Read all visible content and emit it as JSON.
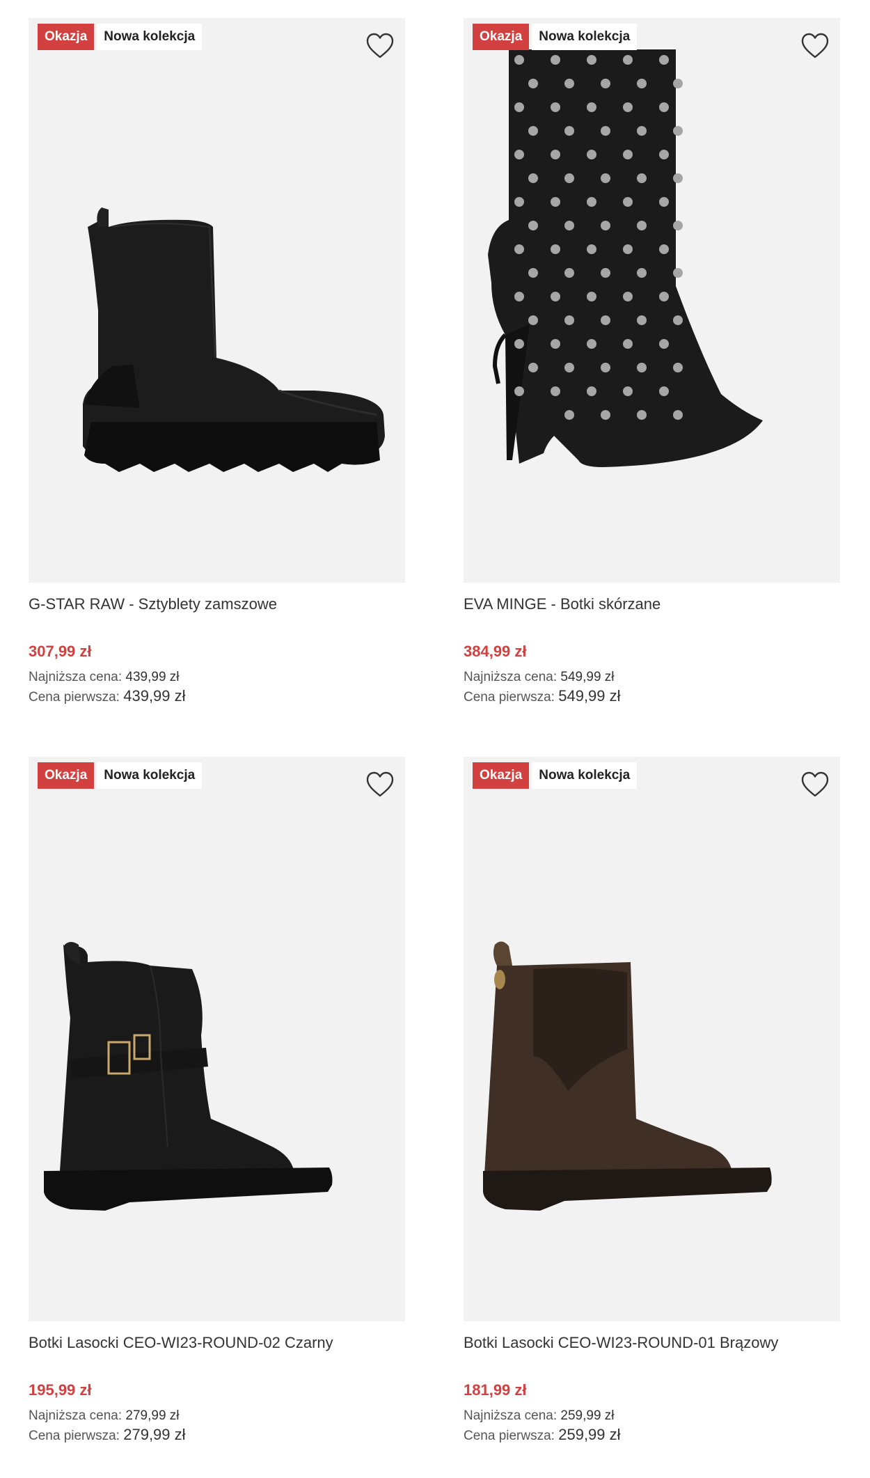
{
  "products": [
    {
      "sale_badge": "Okazja",
      "new_badge": "Nowa kolekcja",
      "title": "G-STAR RAW - Sztyblety zamszowe",
      "price": "307,99 zł",
      "lowest_label": "Najniższa cena:",
      "lowest_value": "439,99 zł",
      "first_label": "Cena pierwsza:",
      "first_value": "439,99 zł",
      "image": "black-suede-chelsea-platform-boot"
    },
    {
      "sale_badge": "Okazja",
      "new_badge": "Nowa kolekcja",
      "title": "EVA MINGE - Botki skórzane",
      "price": "384,99 zł",
      "lowest_label": "Najniższa cena:",
      "lowest_value": "549,99 zł",
      "first_label": "Cena pierwsza:",
      "first_value": "549,99 zł",
      "image": "black-studded-stiletto-ankle-boot"
    },
    {
      "sale_badge": "Okazja",
      "new_badge": "Nowa kolekcja",
      "title": "Botki Lasocki CEO-WI23-ROUND-02 Czarny",
      "price": "195,99 zł",
      "lowest_label": "Najniższa cena:",
      "lowest_value": "279,99 zł",
      "first_label": "Cena pierwsza:",
      "first_value": "279,99 zł",
      "image": "black-leather-buckle-ankle-boot"
    },
    {
      "sale_badge": "Okazja",
      "new_badge": "Nowa kolekcja",
      "title": "Botki Lasocki CEO-WI23-ROUND-01 Brązowy",
      "price": "181,99 zł",
      "lowest_label": "Najniższa cena:",
      "lowest_value": "259,99 zł",
      "first_label": "Cena pierwsza:",
      "first_value": "259,99 zł",
      "image": "brown-suede-chelsea-boot"
    }
  ],
  "colors": {
    "sale": "#d2403f",
    "image_bg": "#f2f2f2"
  },
  "icons": {
    "favorite": "heart-outline-icon"
  }
}
